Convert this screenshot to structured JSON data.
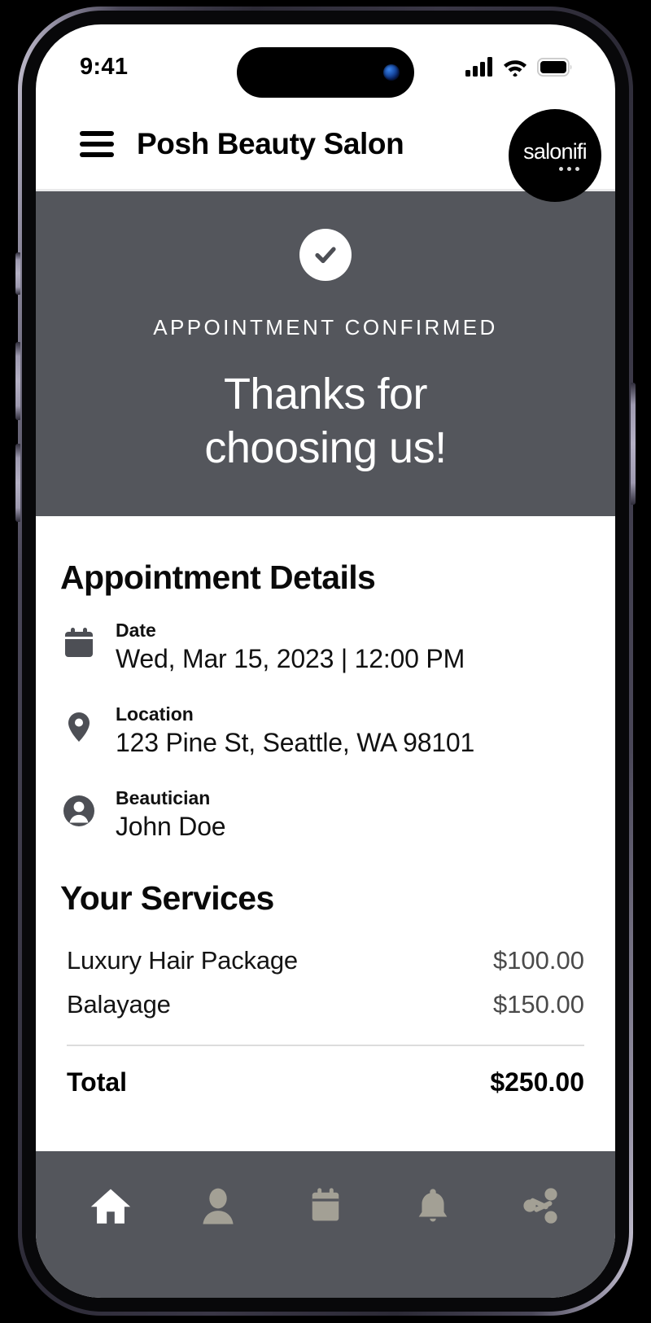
{
  "status_bar": {
    "time": "9:41",
    "icons": [
      "cellular-signal-icon",
      "wifi-icon",
      "battery-icon"
    ]
  },
  "header": {
    "menu_icon": "hamburger-menu-icon",
    "title": "Posh Beauty Salon",
    "brand": {
      "name": "salonifi",
      "dots": 3
    }
  },
  "hero": {
    "check_icon": "check-circle-icon",
    "eyebrow": "APPOINTMENT CONFIRMED",
    "title_line1": "Thanks for",
    "title_line2": "choosing us!",
    "background_color": "#54565c"
  },
  "appointment": {
    "section_title": "Appointment Details",
    "rows": [
      {
        "icon": "calendar-icon",
        "label": "Date",
        "value": "Wed, Mar 15, 2023 | 12:00 PM"
      },
      {
        "icon": "map-pin-icon",
        "label": "Location",
        "value": "123 Pine St, Seattle, WA 98101"
      },
      {
        "icon": "person-icon",
        "label": "Beautician",
        "value": "John Doe"
      }
    ]
  },
  "services": {
    "section_title": "Your Services",
    "items": [
      {
        "name": "Luxury Hair Package",
        "price": "$100.00"
      },
      {
        "name": "Balayage",
        "price": "$150.00"
      }
    ],
    "total_label": "Total",
    "total_price": "$250.00"
  },
  "bottom_nav": {
    "items": [
      {
        "icon": "home-icon",
        "active": true
      },
      {
        "icon": "person-icon",
        "active": false
      },
      {
        "icon": "calendar-icon",
        "active": false
      },
      {
        "icon": "bell-icon",
        "active": false
      },
      {
        "icon": "share-icon",
        "active": false
      }
    ],
    "active_color": "#ffffff",
    "inactive_color": "#a3a095",
    "background_color": "#54565c"
  }
}
